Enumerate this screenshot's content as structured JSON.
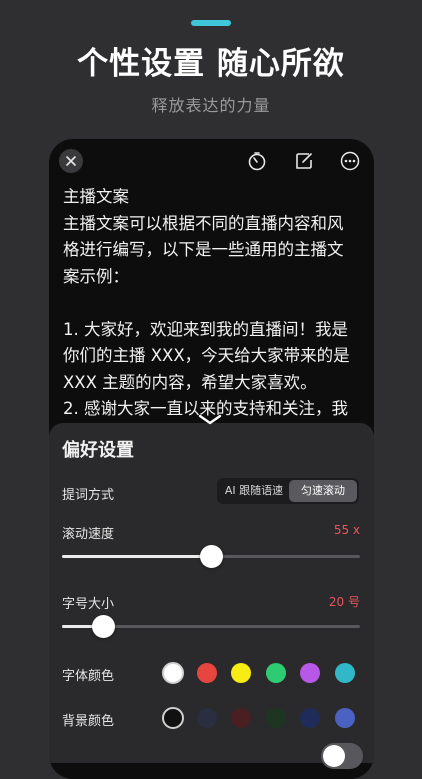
{
  "hero": {
    "title": "个性设置 随心所欲",
    "subtitle": "释放表达的力量",
    "accent_color": "#3fc7d9"
  },
  "toolbar": {
    "icons": [
      "close-icon",
      "timer-icon",
      "edit-icon",
      "more-icon"
    ]
  },
  "script": {
    "lines": [
      "主播文案",
      "主播文案可以根据不同的直播内容和风",
      "格进行编写，以下是一些通用的主播文",
      "案示例：",
      "",
      "1. 大家好，欢迎来到我的直播间！我是",
      "你们的主播 XXX，今天给大家带来的是",
      "XXX 主题的内容，希望大家喜欢。",
      "2. 感谢大家一直以来的支持和关注，我"
    ]
  },
  "settings": {
    "title": "偏好设置",
    "prompt_mode": {
      "label": "提词方式",
      "options": [
        "AI 跟随语速",
        "匀速滚动"
      ],
      "selected": "匀速滚动"
    },
    "scroll_speed": {
      "label": "滚动速度",
      "value_text": "55 x",
      "level": 0.5
    },
    "font_size": {
      "label": "字号大小",
      "value_text": "20 号",
      "level": 0.14
    },
    "font_color": {
      "label": "字体颜色",
      "swatches": [
        "#ffffff",
        "#e5463f",
        "#f7ec13",
        "#2dcc72",
        "#b758e6",
        "#30b8c8"
      ],
      "selected_index": 0
    },
    "bg_color": {
      "label": "背景颜色",
      "swatches": [
        "#111111",
        "#2b2d40",
        "#4a1f22",
        "#1e3522",
        "#1f2c59",
        "#4a63c2"
      ],
      "selected_index": 0
    },
    "accent_red": "#e8565d"
  }
}
